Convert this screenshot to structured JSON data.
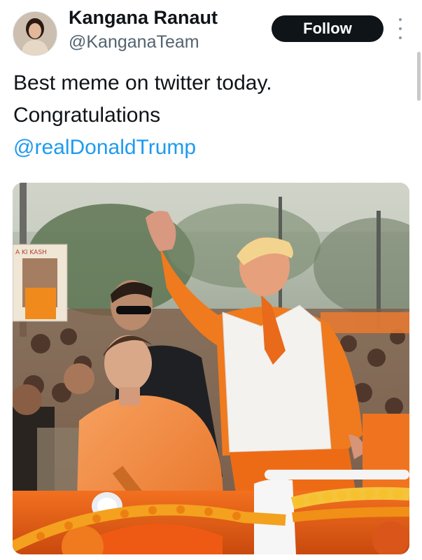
{
  "author": {
    "display_name": "Kangana Ranaut",
    "handle": "@KanganaTeam",
    "avatar_icon": "profile-avatar"
  },
  "actions": {
    "follow_label": "Follow",
    "more_icon": "more-options-icon"
  },
  "tweet": {
    "line1": "Best meme on twitter today.",
    "line2": "Congratulations",
    "mention": "@realDonaldTrump"
  },
  "media": {
    "kind": "photo",
    "banner_text": "A KI KASH"
  },
  "colors": {
    "text": "#0f1419",
    "secondary": "#536471",
    "link": "#1d9bf0",
    "button_bg": "#0f1419",
    "saffron": "#f07a1e"
  }
}
